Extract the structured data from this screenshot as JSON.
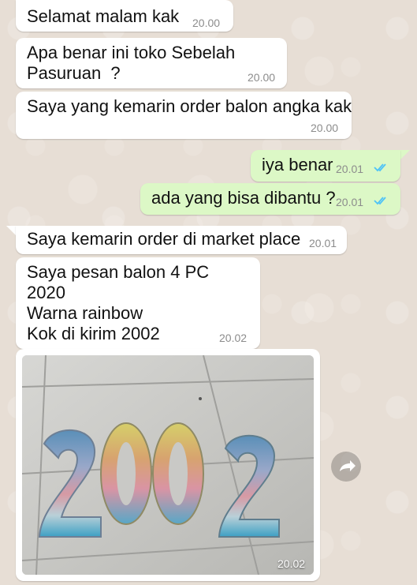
{
  "messages": [
    {
      "text": "Selamat malam kak",
      "time": "20.00"
    },
    {
      "text": "Apa benar ini toko Sebelah\nPasuruan  ?",
      "time": "20.00"
    },
    {
      "text": "Saya yang kemarin order balon angka kak",
      "time": "20.00"
    },
    {
      "text": "iya benar",
      "time": "20.01"
    },
    {
      "text": "ada yang bisa dibantu ?",
      "time": "20.01"
    },
    {
      "text": "Saya kemarin order di market place",
      "time": "20.01"
    },
    {
      "text": "Saya pesan balon 4 PC\n2020\nWarna rainbow\nKok di kirim 2002",
      "time": "20.02"
    }
  ],
  "photo": {
    "time": "20.02",
    "balloon_digits": [
      "2",
      "0",
      "0",
      "2"
    ]
  },
  "colors": {
    "incoming": "#ffffff",
    "outgoing": "#dcf8c6",
    "read_ticks": "#4fc3f7",
    "time": "#8c8c8c"
  },
  "icons": {
    "share": "share-arrow-icon",
    "read": "double-check-icon"
  }
}
